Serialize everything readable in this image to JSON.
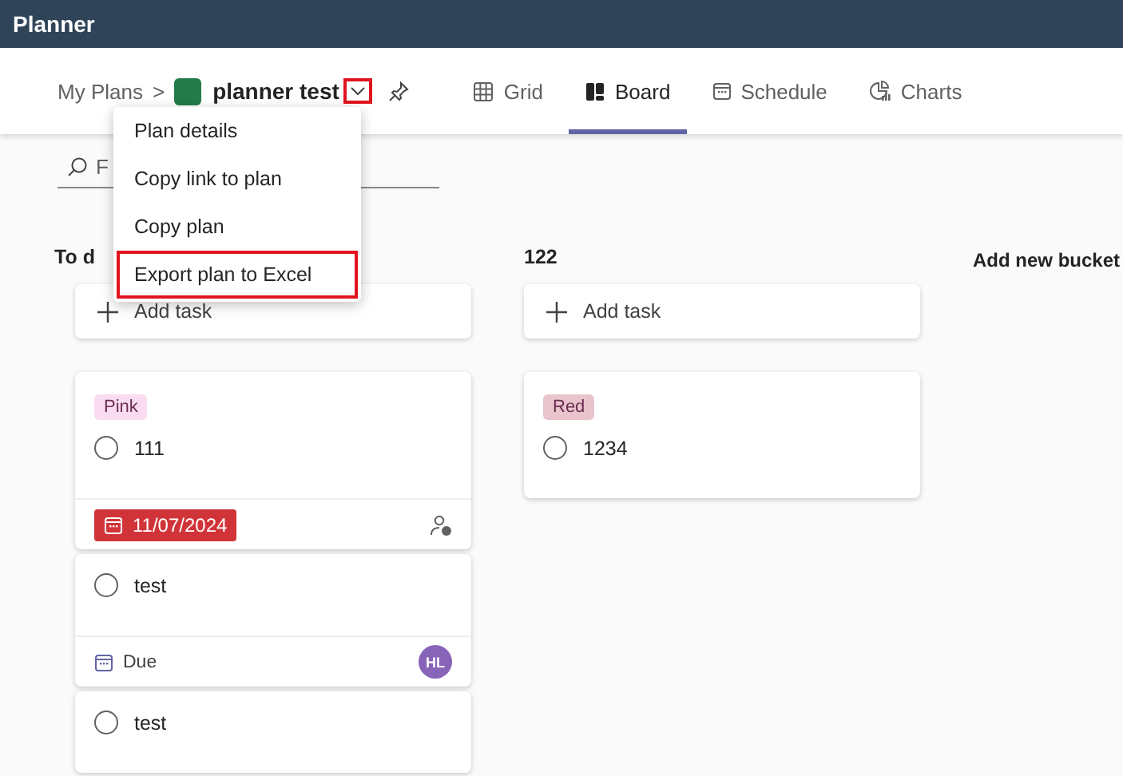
{
  "app_title": "Planner",
  "breadcrumb": {
    "root": "My Plans",
    "separator": ">",
    "plan_name": "planner test",
    "chevron_highlighted": true
  },
  "view_tabs": [
    {
      "label": "Grid",
      "selected": false
    },
    {
      "label": "Board",
      "selected": true
    },
    {
      "label": "Schedule",
      "selected": false
    },
    {
      "label": "Charts",
      "selected": false
    }
  ],
  "plan_menu": [
    {
      "label": "Plan details",
      "highlighted": false
    },
    {
      "label": "Copy link to plan",
      "highlighted": false
    },
    {
      "label": "Copy plan",
      "highlighted": false
    },
    {
      "label": "Export plan to Excel",
      "highlighted": true
    }
  ],
  "search": {
    "placeholder": "F"
  },
  "buckets": [
    {
      "title": "To d",
      "add_label": "Add task",
      "tasks": [
        {
          "label": {
            "text": "Pink",
            "color": "#f9dcef"
          },
          "title": "111",
          "completed": false,
          "footer": {
            "kind": "overdue",
            "date": "11/07/2024"
          }
        },
        {
          "title": "test",
          "completed": false,
          "footer": {
            "kind": "due",
            "date": "Due",
            "avatar": "HL"
          }
        },
        {
          "title": "test",
          "completed": false
        }
      ]
    },
    {
      "title": "122",
      "add_label": "Add task",
      "tasks": [
        {
          "label": {
            "text": "Red",
            "color": "#e9c4cc"
          },
          "title": "1234",
          "completed": false
        }
      ]
    }
  ],
  "add_bucket": "Add new bucket"
}
